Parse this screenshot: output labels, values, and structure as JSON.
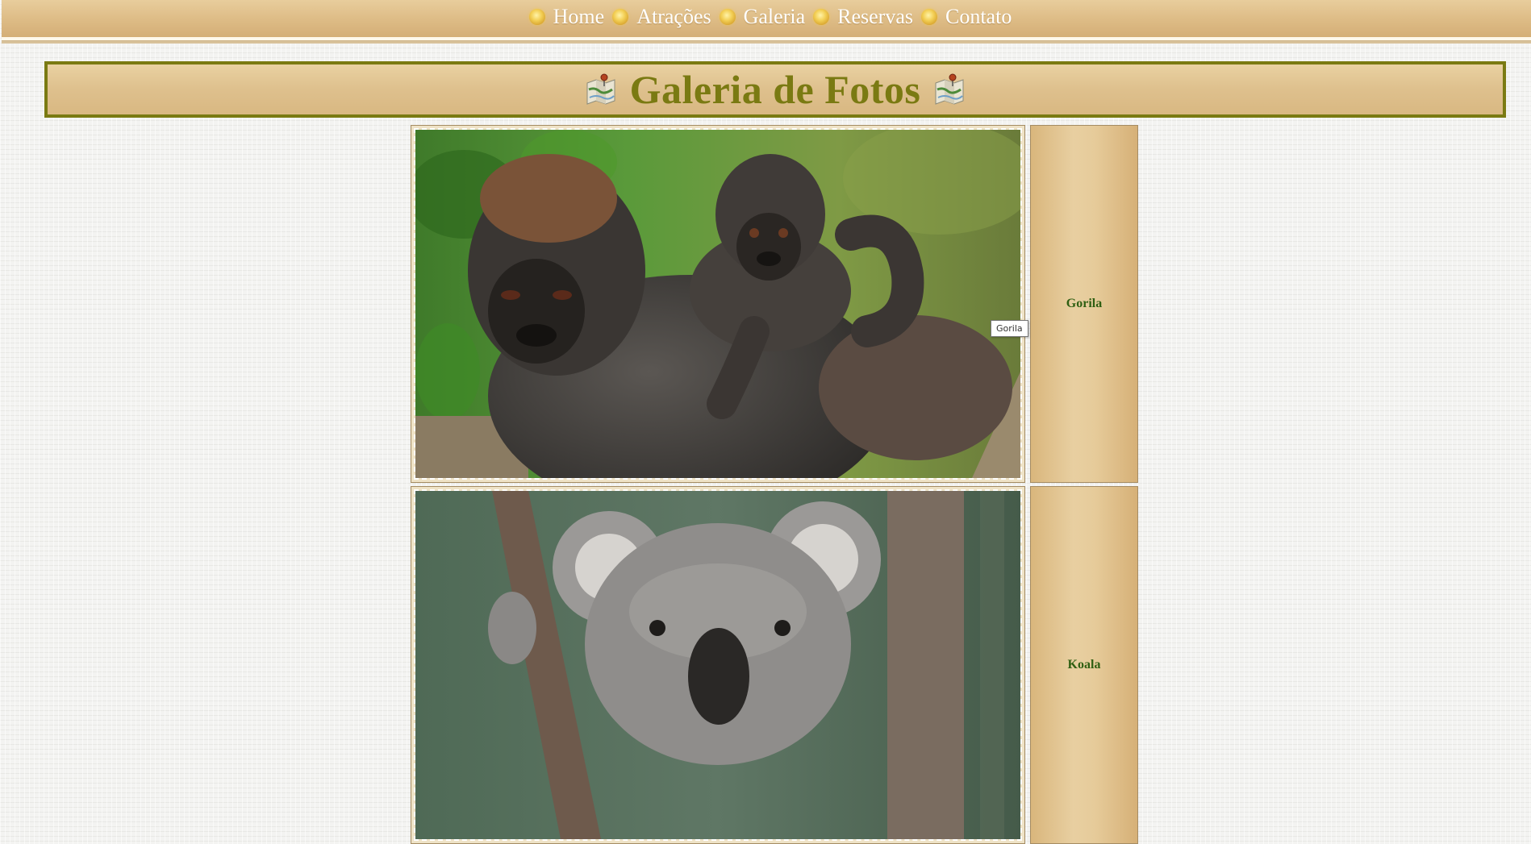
{
  "nav": {
    "items": [
      {
        "label": "Home"
      },
      {
        "label": "Atrações"
      },
      {
        "label": "Galeria"
      },
      {
        "label": "Reservas"
      },
      {
        "label": "Contato"
      }
    ]
  },
  "header": {
    "title": "Galeria de Fotos",
    "icon": "map-pin-icon"
  },
  "gallery": {
    "items": [
      {
        "caption": "Gorila",
        "image": "gorilla-photo"
      },
      {
        "caption": "Koala",
        "image": "koala-photo"
      }
    ]
  },
  "tooltip": {
    "text": "Gorila"
  },
  "colors": {
    "title": "#7a7a12",
    "caption": "#2f5f12",
    "nav_text": "#ffffff",
    "banner_bg": "#dec08d"
  }
}
